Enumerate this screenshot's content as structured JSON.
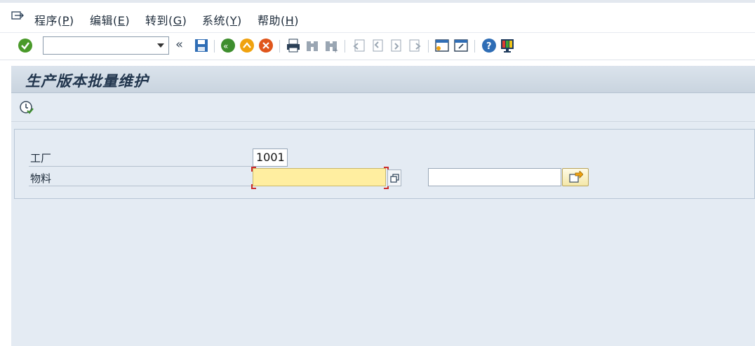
{
  "menu": {
    "items": [
      {
        "text": "程序(",
        "key": "P",
        "end": ")"
      },
      {
        "text": "编辑(",
        "key": "E",
        "end": ")"
      },
      {
        "text": "转到(",
        "key": "G",
        "end": ")"
      },
      {
        "text": "系统(",
        "key": "Y",
        "end": ")"
      },
      {
        "text": "帮助(",
        "key": "H",
        "end": ")"
      }
    ]
  },
  "toolbar": {
    "command_value": "",
    "collapse_glyph": "«"
  },
  "screen": {
    "title": "生产版本批量维护"
  },
  "form": {
    "plant_label": "工厂",
    "plant_value": "1001",
    "material_label": "物料",
    "material_from": "",
    "material_to": ""
  },
  "colors": {
    "required_field": "#ffeea0",
    "background": "#e4ebf3",
    "confirm_green": "#4a9a2a"
  },
  "icons": [
    "menu-icon",
    "enter-icon",
    "save-icon",
    "back-icon",
    "exit-icon",
    "cancel-icon",
    "print-icon",
    "find-icon",
    "find-next-icon",
    "first-page-icon",
    "prev-page-icon",
    "next-page-icon",
    "last-page-icon",
    "new-session-icon",
    "shortcut-icon",
    "help-icon",
    "layout-icon",
    "execute-icon",
    "multiple-selection-icon",
    "arrow-right-icon"
  ]
}
